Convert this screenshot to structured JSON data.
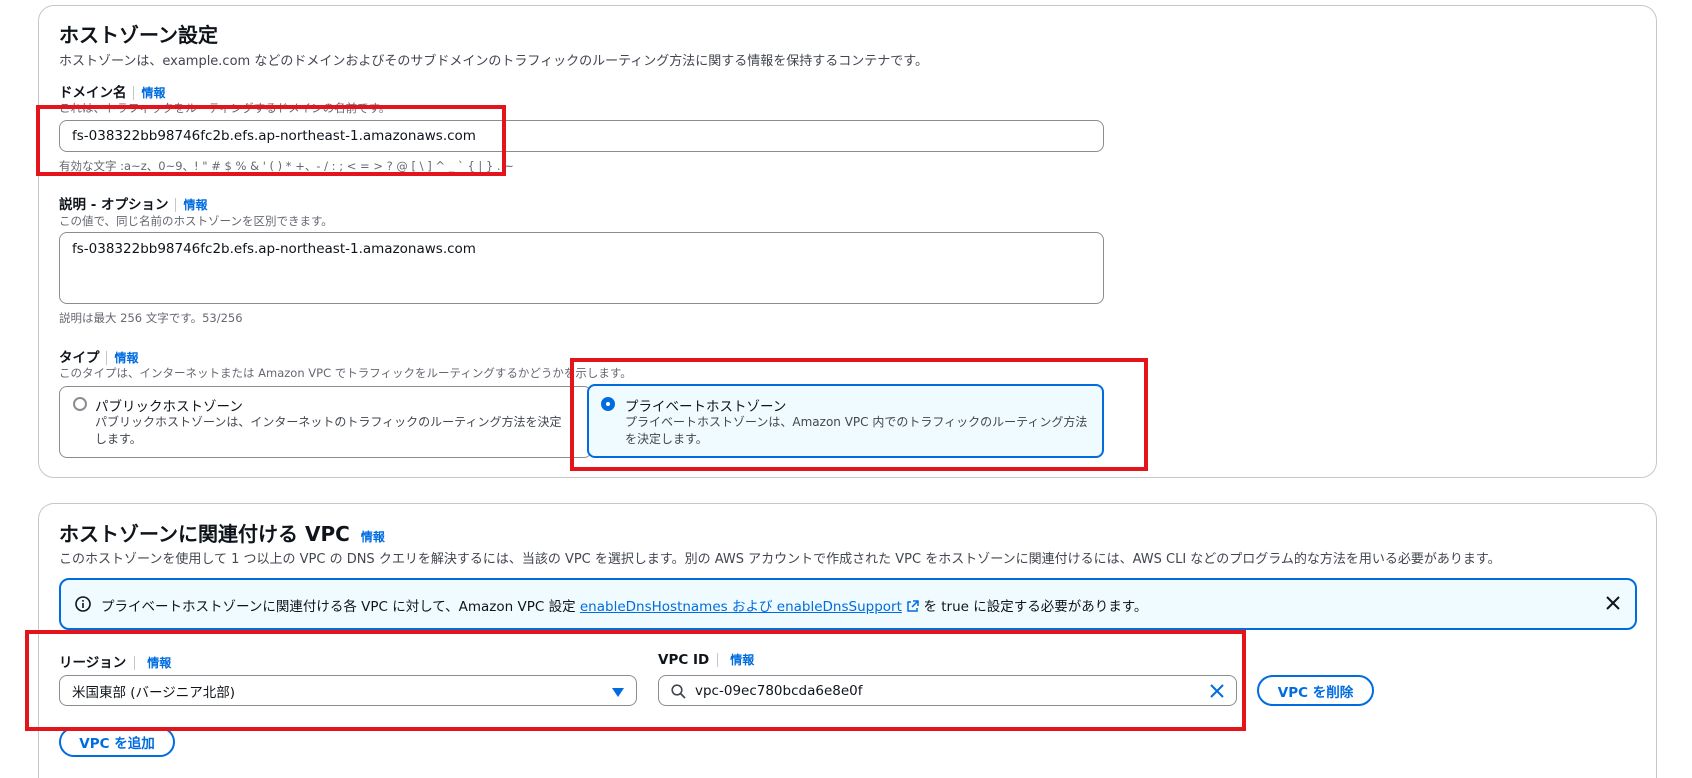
{
  "hosted_zone": {
    "title": "ホストゾーン設定",
    "description": "ホストゾーンは、example.com などのドメインおよびそのサブドメインのトラフィックのルーティング方法に関する情報を保持するコンテナです。",
    "domain": {
      "label": "ドメイン名",
      "info": "情報",
      "helper": "これは、トラフィックをルーティングするドメインの名前です。",
      "value": "fs-038322bb98746fc2b.efs.ap-northeast-1.amazonaws.com",
      "constraint": "有効な文字 :a~z、0~9、! \" # $ % & ' ( ) * +、- / : ; < = > ? @ [ \\ ] ^ _ ` { | } . ~"
    },
    "description_field": {
      "label": "説明 - オプション",
      "info": "情報",
      "helper": "この値で、同じ名前のホストゾーンを区別できます。",
      "value": "fs-038322bb98746fc2b.efs.ap-northeast-1.amazonaws.com",
      "counter": "説明は最大 256 文字です。53/256"
    },
    "type": {
      "label": "タイプ",
      "info": "情報",
      "helper": "このタイプは、インターネットまたは Amazon VPC でトラフィックをルーティングするかどうかを示します。",
      "options": [
        {
          "title": "パブリックホストゾーン",
          "desc": "パブリックホストゾーンは、インターネットのトラフィックのルーティング方法を決定します。",
          "selected": false
        },
        {
          "title": "プライベートホストゾーン",
          "desc": "プライベートホストゾーンは、Amazon VPC 内でのトラフィックのルーティング方法を決定します。",
          "selected": true
        }
      ]
    }
  },
  "vpc_section": {
    "title": "ホストゾーンに関連付ける VPC",
    "info": "情報",
    "description": "このホストゾーンを使用して 1 つ以上の VPC の DNS クエリを解決するには、当該の VPC を選択します。別の AWS アカウントで作成された VPC をホストゾーンに関連付けるには、AWS CLI などのプログラム的な方法を用いる必要があります。",
    "alert": {
      "text_before": "プライベートホストゾーンに関連付ける各 VPC に対して、Amazon VPC 設定 ",
      "link": "enableDnsHostnames および enableDnsSupport",
      "text_after": " を true に設定する必要があります。"
    },
    "region": {
      "label": "リージョン",
      "info": "情報",
      "value": "米国東部 (バージニア北部)"
    },
    "vpc_id": {
      "label": "VPC ID",
      "info": "情報",
      "value": "vpc-09ec780bcda6e8e0f"
    },
    "remove_button": "VPC を削除",
    "add_button": "VPC を追加"
  },
  "colors": {
    "accent": "#006ce0",
    "highlight": "#e3141c"
  }
}
